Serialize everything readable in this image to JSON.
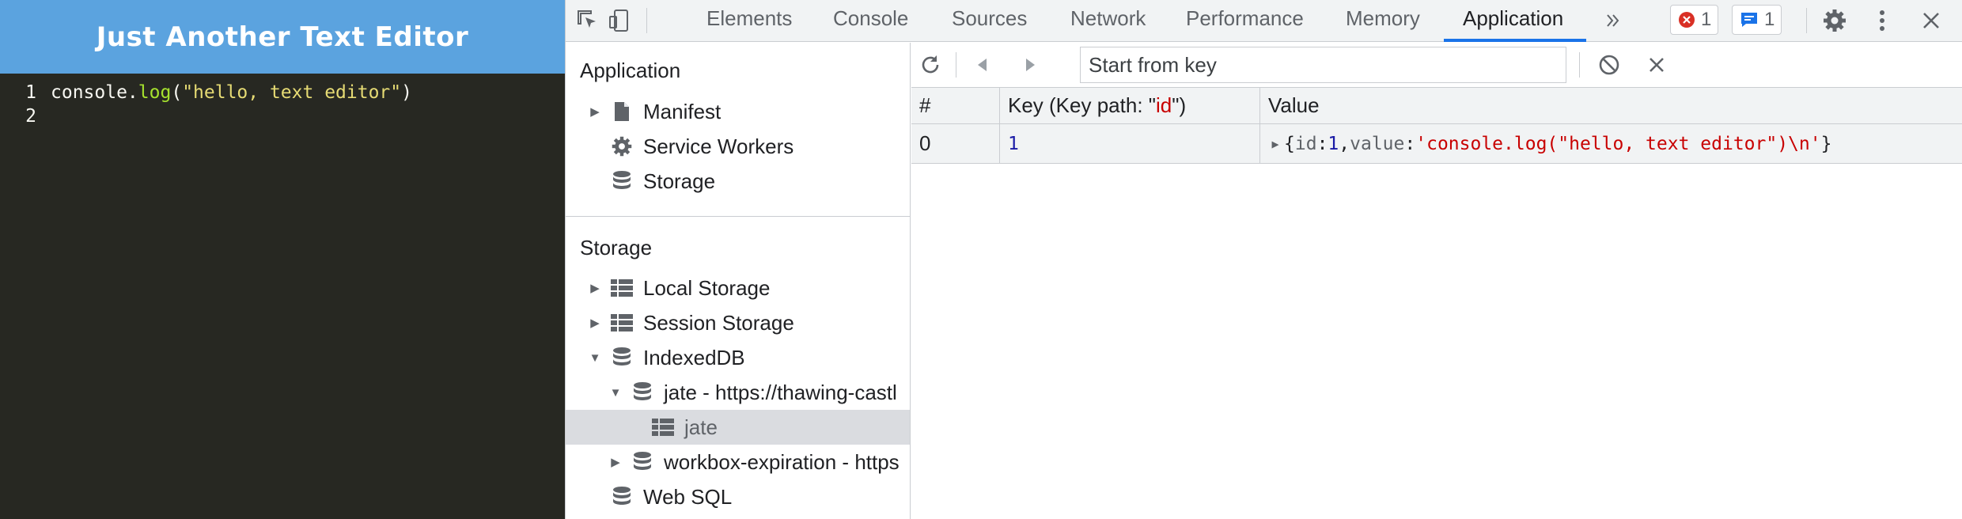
{
  "editor": {
    "title": "Just Another Text Editor",
    "lines": [
      {
        "number": "1",
        "parts": {
          "obj": "console.",
          "fn": "log",
          "open": "(",
          "str": "\"hello, text editor\"",
          "close": ")"
        }
      },
      {
        "number": "2",
        "text": ""
      }
    ]
  },
  "devtools": {
    "tabs": [
      "Elements",
      "Console",
      "Sources",
      "Network",
      "Performance",
      "Memory",
      "Application"
    ],
    "active_tab": "Application",
    "more_tabs_icon": "double-chevron-icon",
    "error_count": "1",
    "message_count": "1",
    "sidebar": {
      "application_section": "Application",
      "application_items": [
        "Manifest",
        "Service Workers",
        "Storage"
      ],
      "storage_section": "Storage",
      "storage_items": {
        "local_storage": "Local Storage",
        "session_storage": "Session Storage",
        "indexeddb": "IndexedDB",
        "db_jate": "jate - https://thawing-castl",
        "store_jate": "jate",
        "db_workbox": "workbox-expiration - https",
        "web_sql": "Web SQL"
      }
    },
    "main": {
      "key_input_placeholder": "Start from key",
      "columns": {
        "index": "#",
        "key_prefix": "Key (Key path: \"",
        "key_path": "id",
        "key_suffix": "\")",
        "value": "Value"
      },
      "rows": [
        {
          "index": "0",
          "key": "1",
          "value": {
            "open": "{",
            "k1": "id",
            "colon1": ": ",
            "v1": "1",
            "comma": ", ",
            "k2": "value",
            "colon2": ": ",
            "v2": "'console.log(\"hello, text editor\")\\n'",
            "close": "}"
          }
        }
      ]
    },
    "colors": {
      "accent": "#1a73e8",
      "error": "#d93025",
      "editor_bg": "#272822",
      "header_bg": "#5ba3df"
    }
  }
}
